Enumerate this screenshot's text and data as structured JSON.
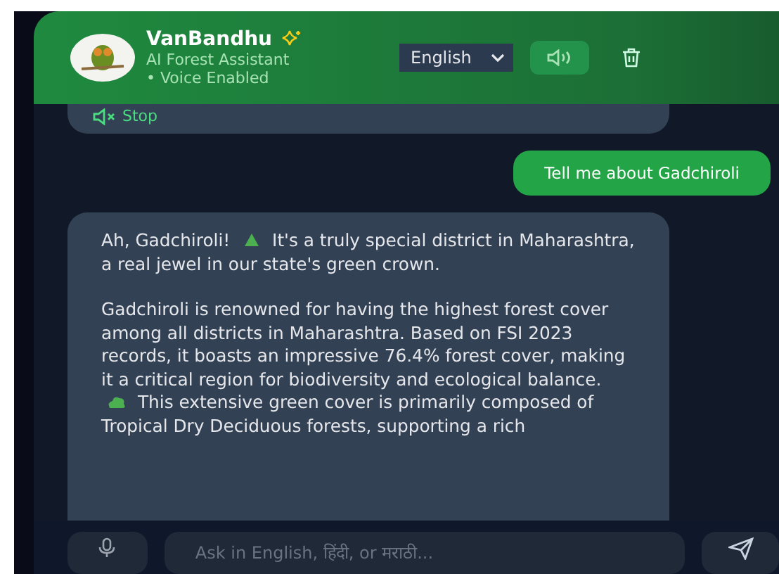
{
  "header": {
    "title": "VanBandhu",
    "subtitle": "AI Forest Assistant",
    "status": "• Voice Enabled",
    "language": "English",
    "voice_on": true
  },
  "messages": [
    {
      "kind": "stop",
      "stop_label": "Stop"
    },
    {
      "kind": "user",
      "text": "Tell me about Gadchiroli"
    },
    {
      "kind": "text",
      "paragraphs": [
        {
          "before": "Ah, Gadchiroli!",
          "after": "It's a truly special district in Maharashtra, a real jewel in our state's green crown."
        },
        {
          "before": "Gadchiroli is renowned for having the highest forest cover among all districts in Maharashtra. Based on FSI 2023 records, it boasts an impressive 76.4% forest cover, making it a critical region for biodiversity and ecological balance.",
          "after": "This extensive green cover is primarily composed of Tropical Dry Deciduous forests, supporting a rich"
        }
      ]
    }
  ],
  "input": {
    "placeholder": "Ask in English, हिंदी, or मराठी..."
  }
}
